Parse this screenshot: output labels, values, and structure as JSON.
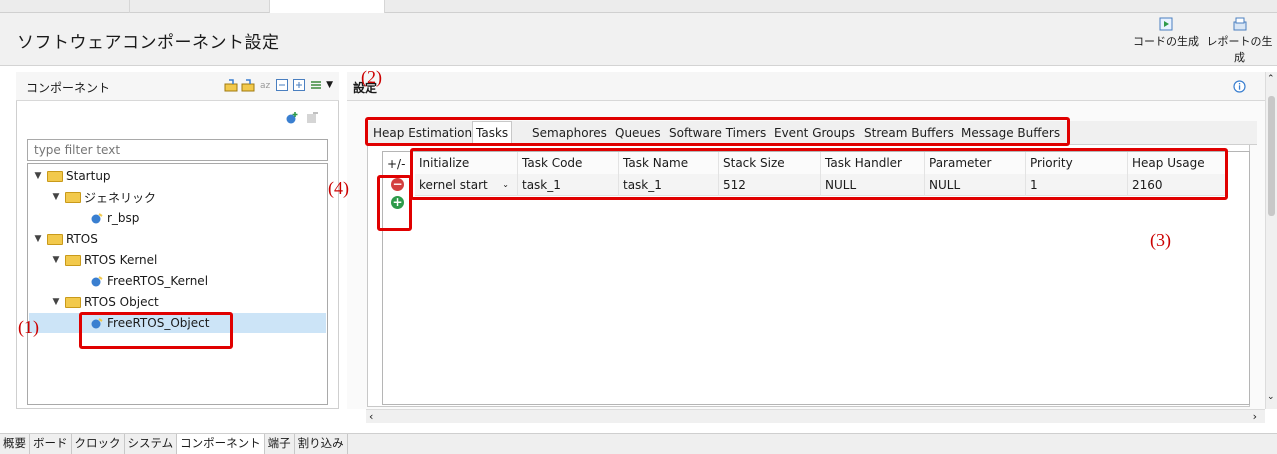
{
  "window": {
    "title": "ソフトウェアコンポーネント設定"
  },
  "header_buttons": {
    "generate_code": "コードの生成",
    "generate_report": "レポートの生成"
  },
  "left": {
    "title": "コンポーネント",
    "filter_placeholder": "type filter text",
    "tree": {
      "startup": "Startup",
      "generic": "ジェネリック",
      "r_bsp": "r_bsp",
      "rtos": "RTOS",
      "rtos_kernel": "RTOS Kernel",
      "freertos_kernel": "FreeRTOS_Kernel",
      "rtos_object": "RTOS Object",
      "freertos_object": "FreeRTOS_Object"
    }
  },
  "right": {
    "title": "設定",
    "tabs": [
      "Heap Estimation",
      "Tasks",
      "Semaphores",
      "Queues",
      "Software Timers",
      "Event Groups",
      "Stream Buffers",
      "Message Buffers"
    ],
    "active_tab": "Tasks",
    "table": {
      "pm_header": "+/-",
      "columns": [
        "Initialize",
        "Task Code",
        "Task Name",
        "Stack Size",
        "Task Handler",
        "Parameter",
        "Priority",
        "Heap Usage"
      ],
      "rows": [
        [
          "kernel start",
          "task_1",
          "task_1",
          "512",
          "NULL",
          "NULL",
          "1",
          "2160"
        ]
      ]
    }
  },
  "annotations": {
    "a1": "(1)",
    "a2": "(2)",
    "a3": "(3)",
    "a4": "(4)"
  },
  "bottom_tabs": [
    "概要",
    "ボード",
    "クロック",
    "システム",
    "コンポーネント",
    "端子",
    "割り込み"
  ],
  "active_bottom_tab": "コンポーネント",
  "colors": {
    "highlight": "#e00000",
    "selection": "#cce4f7",
    "remove": "#d33f3f",
    "add": "#2e9a4a"
  }
}
